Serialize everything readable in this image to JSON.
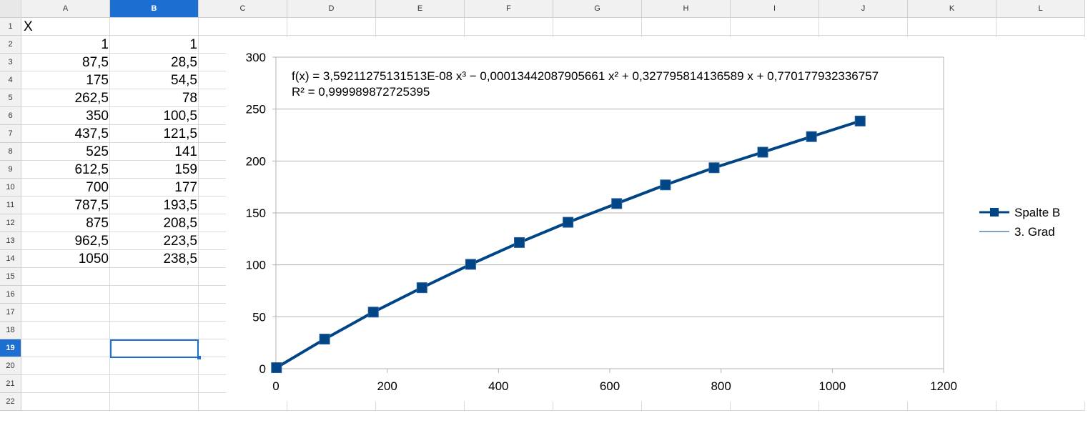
{
  "columns": [
    "A",
    "B",
    "C",
    "D",
    "E",
    "F",
    "G",
    "H",
    "I",
    "J",
    "K",
    "L"
  ],
  "selected_column": "B",
  "rows": [
    "1",
    "2",
    "3",
    "4",
    "5",
    "6",
    "7",
    "8",
    "9",
    "10",
    "11",
    "12",
    "13",
    "14",
    "15",
    "16",
    "17",
    "18",
    "19",
    "20",
    "21",
    "22"
  ],
  "selected_row": "19",
  "cells": {
    "A1": "X",
    "A": [
      "1",
      "87,5",
      "175",
      "262,5",
      "350",
      "437,5",
      "525",
      "612,5",
      "700",
      "787,5",
      "875",
      "962,5",
      "1050"
    ],
    "B": [
      "1",
      "28,5",
      "54,5",
      "78",
      "100,5",
      "121,5",
      "141",
      "159",
      "177",
      "193,5",
      "208,5",
      "223,5",
      "238,5"
    ]
  },
  "chart_data": {
    "type": "line",
    "x": [
      1,
      87.5,
      175,
      262.5,
      350,
      437.5,
      525,
      612.5,
      700,
      787.5,
      875,
      962.5,
      1050
    ],
    "series": [
      {
        "name": "Spalte B",
        "values": [
          1,
          28.5,
          54.5,
          78,
          100.5,
          121.5,
          141,
          159,
          177,
          193.5,
          208.5,
          223.5,
          238.5
        ],
        "color": "#004586",
        "marker": "square"
      },
      {
        "name": "3. Grad",
        "trendline": "polynomial-3",
        "color": "#004586"
      }
    ],
    "xlim": [
      0,
      1200
    ],
    "ylim": [
      0,
      300
    ],
    "xticks": [
      "0",
      "200",
      "400",
      "600",
      "800",
      "1000",
      "1200"
    ],
    "yticks": [
      "0",
      "50",
      "100",
      "150",
      "200",
      "250",
      "300"
    ],
    "equation": "f(x) = 3,59211275131513E-08 x³ − 0,00013442087905661 x² + 0,327795814136589 x + 0,770177932336757",
    "r_squared": "R² = 0,999989872725395",
    "grid": true,
    "legend_position": "right"
  }
}
